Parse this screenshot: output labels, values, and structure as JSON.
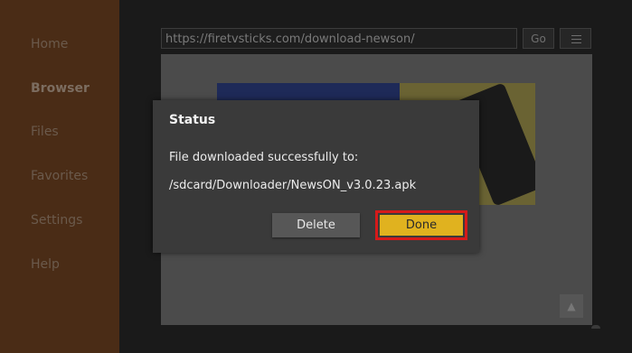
{
  "sidebar": {
    "items": [
      {
        "label": "Home"
      },
      {
        "label": "Browser"
      },
      {
        "label": "Files"
      },
      {
        "label": "Favorites"
      },
      {
        "label": "Settings"
      },
      {
        "label": "Help"
      }
    ]
  },
  "browser": {
    "url": "https://firetvsticks.com/download-newson/",
    "go_label": "Go",
    "menu_icon": "hamburger-menu-icon",
    "scroll_icon": "arrow-up-icon"
  },
  "dialog": {
    "title": "Status",
    "message": "File downloaded successfully to:",
    "path": "/sdcard/Downloader/NewsON_v3.0.23.apk",
    "delete_label": "Delete",
    "done_label": "Done"
  },
  "colors": {
    "sidebar_bg": "#4a2c16",
    "done_button": "#e0b21f",
    "highlight_border": "#d61a1a"
  }
}
